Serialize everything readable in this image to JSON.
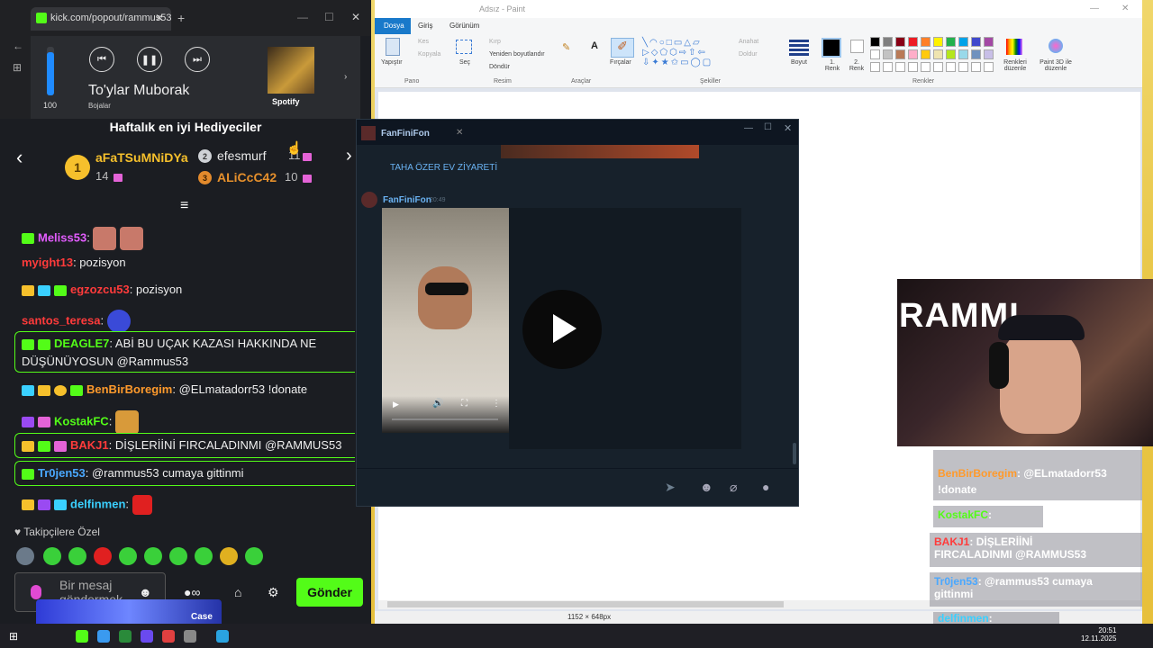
{
  "browser": {
    "tab_title": "kick.com/popout/rammus53/cl",
    "new_tab": "+"
  },
  "media": {
    "volume": "100",
    "song": "To'ylar Muborak",
    "artist": "Bojalar",
    "service": "Spotify"
  },
  "gifters": {
    "title": "Haftalık en iyi Hediyeciler",
    "first": {
      "rank": "1",
      "name": "aFaTSuMNiDYa",
      "count": "14"
    },
    "second": {
      "rank": "2",
      "name": "efesmurf",
      "count": "11"
    },
    "third": {
      "rank": "3",
      "name": "ALiCcC42",
      "count": "10"
    }
  },
  "chat": [
    {
      "user": "Meliss53",
      "text": "",
      "color": "#e35cff"
    },
    {
      "user": "myight13",
      "text": ": pozisyon",
      "color": "#ff3b3b"
    },
    {
      "user": "egzozcu53",
      "text": ": pozisyon",
      "color": "#ff3b3b"
    },
    {
      "user": "santos_teresa",
      "text": ":",
      "color": "#ff3b3b"
    },
    {
      "user": "DEAGLE7",
      "text": ": ABİ BU UÇAK KAZASI HAKKINDA NE",
      "text2": "DÜŞÜNÜYOSUN @Rammus53",
      "color": "#53fc18"
    },
    {
      "user": "BenBirBoregim",
      "text": ": @ELmatadorr53 !donate",
      "color": "#ff9a2c"
    },
    {
      "user": "KostakFC",
      "text": ":",
      "color": "#53fc18"
    },
    {
      "user": "BAKJ1",
      "text": ": DİŞLERİİNİ FIRCALADINMI @RAMMUS53",
      "color": "#ff3b3b"
    },
    {
      "user": "Tr0jen53",
      "text": ": @rammus53 cumaya gittinmi",
      "color": "#4aa8ff"
    },
    {
      "user": "delfinmen",
      "text": ":",
      "color": "#3ad0ff"
    }
  ],
  "footer": {
    "followers_label": "♥ Takipçilere Özel",
    "message_placeholder": "Bir mesaj göndermek",
    "send": "Gönder",
    "overlay_label": "Case"
  },
  "paint": {
    "title": "Adsız - Paint",
    "menu": [
      "Dosya",
      "Giriş",
      "Görünüm"
    ],
    "groups": {
      "pano": "Pano",
      "resim": "Resim",
      "araclar": "Araçlar",
      "sekiller": "Şekiller",
      "renkler": "Renkler"
    },
    "tools": {
      "paste": "Yapıştır",
      "cut": "Kes",
      "copy": "Kopyala",
      "select": "Seç",
      "crop": "Kırp",
      "resize": "Yeniden boyutlandır",
      "rotate": "Döndür",
      "brushes": "Fırçalar",
      "outline": "Anahat",
      "fill": "Doldur",
      "size": "Boyut",
      "color1": "1. Renk",
      "color2": "2. Renk",
      "edit_colors": "Renkleri düzenle",
      "paint3d": "Paint 3D ile düzenle"
    },
    "status_size": "1152 × 648px",
    "palette": [
      "#000000",
      "#7f7f7f",
      "#880015",
      "#ed1c24",
      "#ff7f27",
      "#fff200",
      "#22b14c",
      "#00a2e8",
      "#3f48cc",
      "#a349a4",
      "#ffffff",
      "#c3c3c3",
      "#b97a57",
      "#ffaec9",
      "#ffc90e",
      "#efe4b0",
      "#b5e61d",
      "#99d9ea",
      "#7092be",
      "#c8bfe7"
    ]
  },
  "telegram": {
    "contact": "FanFiniFon",
    "prev_caption": "TAHA ÖZER EV ZİYARETİ",
    "sender": "FanFiniFon",
    "time": "20:49"
  },
  "webcam": {
    "banner": "RAMMI"
  },
  "overlay": [
    {
      "user": "BenBirBoregim",
      "text": ": @ELmatadorr53",
      "text2": "!donate"
    },
    {
      "user": "KostakFC",
      "text": ":"
    },
    {
      "user": "BAKJ1",
      "text": ": DİŞLERİİNİ",
      "text2": "FIRCALADINMI @RAMMUS53"
    },
    {
      "user": "Tr0jen53",
      "text": ": @rammus53 cumaya",
      "text2": "gittinmi"
    },
    {
      "user": "delfinmen",
      "text": ":"
    }
  ],
  "taskbar": {
    "time": "20:51",
    "date": "12.11.2025"
  }
}
